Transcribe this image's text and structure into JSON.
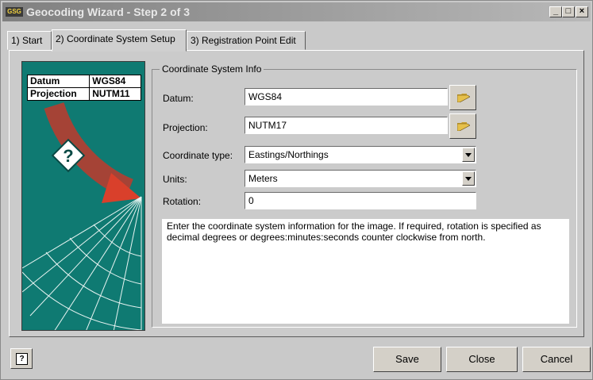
{
  "window": {
    "icon_text": "GSG",
    "title": "Geocoding Wizard - Step 2 of 3",
    "controls": {
      "minimize": "_",
      "maximize": "□",
      "close": "×"
    }
  },
  "tabs": [
    {
      "label": "1) Start"
    },
    {
      "label": "2) Coordinate System Setup"
    },
    {
      "label": "3) Registration Point Edit"
    }
  ],
  "illustration": {
    "rows": [
      {
        "key": "Datum",
        "value": "WGS84"
      },
      {
        "key": "Projection",
        "value": "NUTM11"
      }
    ],
    "question_mark": "?"
  },
  "group": {
    "title": "Coordinate System Info",
    "datum_label": "Datum:",
    "datum_value": "WGS84",
    "projection_label": "Projection:",
    "projection_value": "NUTM17",
    "coord_type_label": "Coordinate type:",
    "coord_type_value": "Eastings/Northings",
    "units_label": "Units:",
    "units_value": "Meters",
    "rotation_label": "Rotation:",
    "rotation_value": "0",
    "description": "Enter the coordinate system information for the image. If required, rotation is specified as decimal degrees or degrees:minutes:seconds counter clockwise from north."
  },
  "footer": {
    "help_glyph": "?",
    "save": "Save",
    "close": "Close",
    "cancel": "Cancel"
  }
}
